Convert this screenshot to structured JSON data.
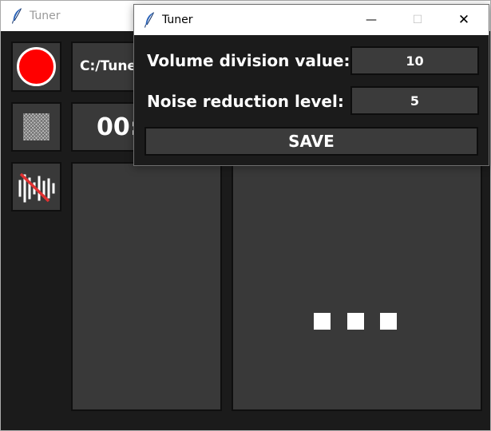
{
  "main_window": {
    "title": "Tuner",
    "file_path": "C:/Tuner",
    "timer": "00:00"
  },
  "settings_dialog": {
    "title": "Tuner",
    "window_controls": {
      "minimize": "—",
      "maximize": "☐",
      "close": "✕"
    },
    "volume_label": "Volume division value:",
    "volume_value": "10",
    "noise_label": "Noise reduction level:",
    "noise_value": "5",
    "save_label": "SAVE"
  },
  "icons": {
    "app": "feather-icon",
    "record": "record-icon",
    "stop": "stop-icon",
    "noise": "noise-reduction-off-icon",
    "loading": "loading-dots-icon"
  },
  "colors": {
    "background": "#1b1b1b",
    "tile": "#393939",
    "record": "#ff0000",
    "feather": "#2a63b8"
  }
}
